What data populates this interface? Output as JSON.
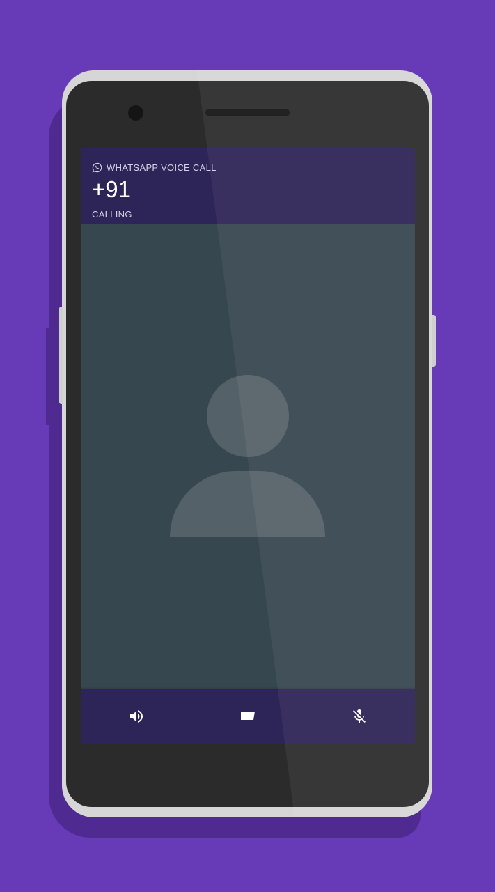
{
  "call": {
    "app_name": "WHATSAPP VOICE CALL",
    "caller_number": "+91",
    "status": "CALLING"
  },
  "icons": {
    "app": "whatsapp-icon",
    "end_call": "call-end-icon",
    "speaker": "speaker-icon",
    "message": "message-icon",
    "mute": "mic-off-icon"
  },
  "colors": {
    "background": "#673ab7",
    "header": "#2d2457",
    "contact_bg": "#37474f",
    "end_call": "#e91e4b"
  }
}
